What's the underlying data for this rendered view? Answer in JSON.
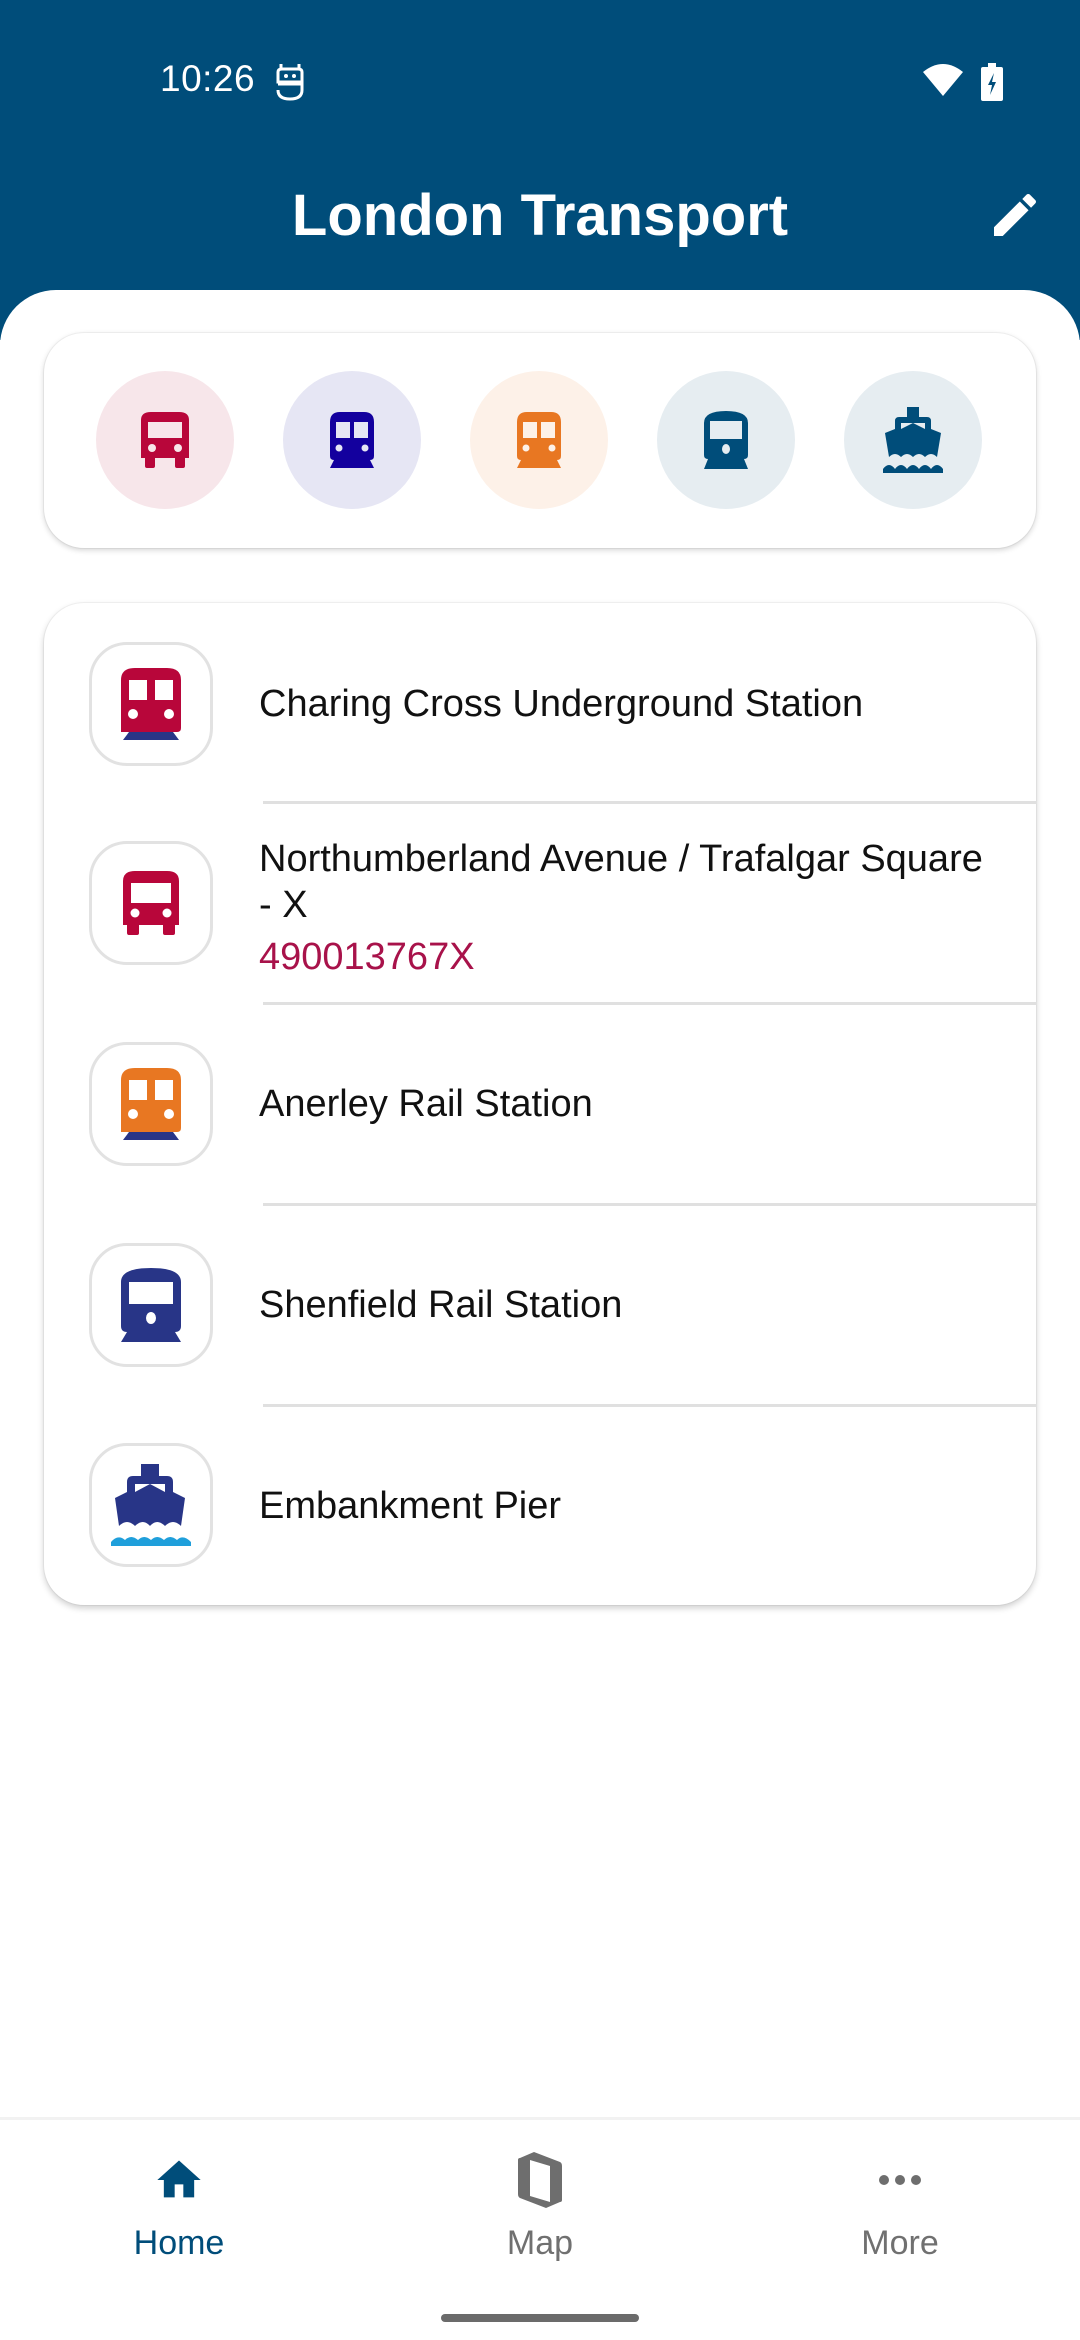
{
  "status_bar": {
    "time": "10:26",
    "app_icon": "notification-app-icon",
    "wifi_icon": "wifi-icon",
    "battery_icon": "battery-charging-icon"
  },
  "header": {
    "title": "London Transport",
    "edit_icon": "pencil-icon"
  },
  "modes": [
    {
      "name": "bus",
      "icon": "bus-icon",
      "color": "#B8063A",
      "bg": "#F7E6EA"
    },
    {
      "name": "underground",
      "icon": "tube-train-icon",
      "color": "#13009E",
      "bg": "#E6E6F4"
    },
    {
      "name": "overground",
      "icon": "overground-train-icon",
      "color": "#E87722",
      "bg": "#FDF1E8"
    },
    {
      "name": "rail",
      "icon": "rail-train-icon",
      "color": "#004D7A",
      "bg": "#E6EDF1"
    },
    {
      "name": "river",
      "icon": "ferry-icon",
      "color": "#004D7A",
      "bg": "#E6EDF1"
    }
  ],
  "favourites": [
    {
      "title": "Charing Cross Underground Station",
      "code": null,
      "icon": "underground-station-icon"
    },
    {
      "title": "Northumberland Avenue / Trafalgar Square - X",
      "code": "490013767X",
      "icon": "bus-stop-icon"
    },
    {
      "title": "Anerley Rail Station",
      "code": null,
      "icon": "overground-station-icon"
    },
    {
      "title": "Shenfield Rail Station",
      "code": null,
      "icon": "rail-station-icon"
    },
    {
      "title": "Embankment Pier",
      "code": null,
      "icon": "pier-icon"
    }
  ],
  "colors": {
    "primary": "#004D7A",
    "bus_red": "#B8063A",
    "tube_blue": "#13009E",
    "overground_orange": "#E87722",
    "station_navy": "#283587",
    "river_cyan": "#1F9FDB",
    "code_text": "#A8124A"
  },
  "bottom_nav": {
    "items": [
      {
        "label": "Home",
        "icon": "home-icon",
        "active": true
      },
      {
        "label": "Map",
        "icon": "map-icon",
        "active": false
      },
      {
        "label": "More",
        "icon": "more-horizontal-icon",
        "active": false
      }
    ]
  }
}
